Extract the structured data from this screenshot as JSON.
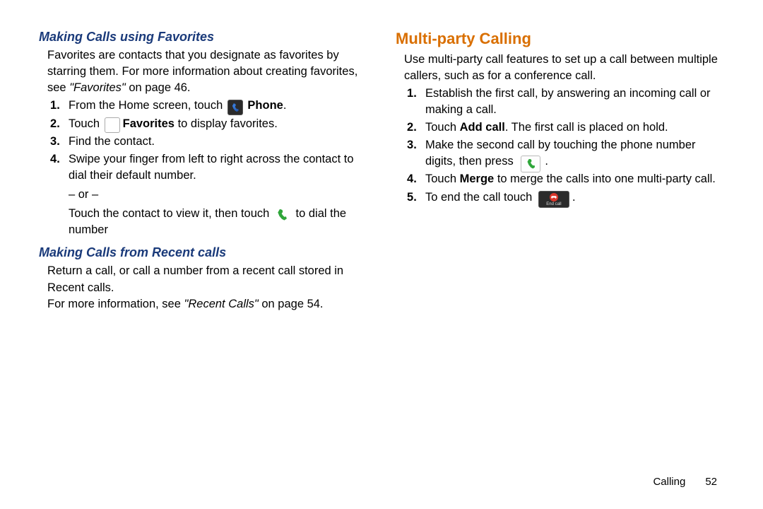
{
  "left": {
    "h_fav": "Making Calls using Favorites",
    "fav_intro_a": "Favorites are contacts that you designate as favorites by starring them. For more information about creating favorites, see ",
    "fav_intro_ref": "\"Favorites\"",
    "fav_intro_b": " on page 46.",
    "steps": {
      "s1_a": "From the Home screen, touch ",
      "s1_b": " Phone",
      "s1_c": ".",
      "s2_a": "Touch ",
      "s2_b": "Favorites",
      "s2_c": " to display favorites.",
      "s3": "Find the contact.",
      "s4_a": "Swipe your finger from left to right across the contact to dial their default number.",
      "s4_or": "– or –",
      "s4_b1": "Touch the contact to view it, then touch ",
      "s4_b2": " to dial the number"
    },
    "h_recent": "Making Calls from Recent calls",
    "recent_p1": "Return a call, or call a number from a recent call stored in Recent calls.",
    "recent_p2a": "For more information, see ",
    "recent_p2ref": "\"Recent Calls\"",
    "recent_p2b": " on page 54."
  },
  "right": {
    "h_multi": "Multi-party Calling",
    "intro": "Use multi-party call features to set up a call between multiple callers, such as for a conference call.",
    "steps": {
      "s1": "Establish the first call, by answering an incoming call or making a call.",
      "s2_a": "Touch ",
      "s2_b": "Add call",
      "s2_c": ". The first call is placed on hold.",
      "s3_a": "Make the second call by touching the phone number digits, then press ",
      "s3_b": ".",
      "s4_a": "Touch ",
      "s4_b": "Merge",
      "s4_c": " to merge the calls into one multi-party call.",
      "s5_a": "To end the call touch ",
      "s5_b": "."
    }
  },
  "icons": {
    "endcall_label": "End call"
  },
  "footer": {
    "section": "Calling",
    "page": "52"
  }
}
